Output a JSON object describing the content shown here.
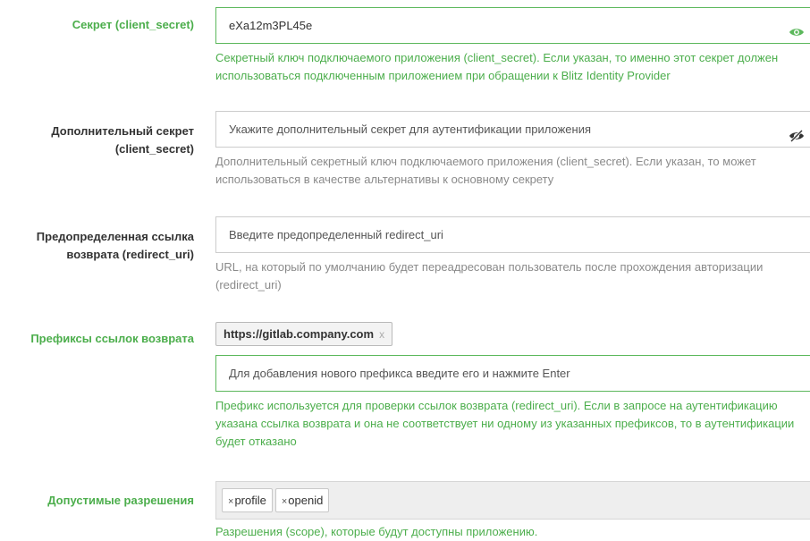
{
  "secret": {
    "label": "Секрет (client_secret)",
    "value": "eXa12m3PL45e",
    "icon": "eye-icon",
    "help": "Секретный ключ подключаемого приложения (client_secret). Если указан, то именно этот секрет должен использоваться подключенным приложением при обращении к Blitz Identity Provider"
  },
  "additional_secret": {
    "label_line1": "Дополнительный секрет",
    "label_line2": "(client_secret)",
    "placeholder": "Укажите дополнительный секрет для аутентификации приложения",
    "icon": "eye-slash-icon",
    "help": "Дополнительный секретный ключ подключаемого приложения (client_secret). Если указан, то может использоваться в качестве альтернативы к основному секрету"
  },
  "redirect_uri": {
    "label_line1": "Предопределенная ссылка",
    "label_line2": "возврата (redirect_uri)",
    "placeholder": "Введите предопределенный redirect_uri",
    "help": "URL, на который по умолчанию будет переадресован пользователь после прохождения авторизации (redirect_uri)"
  },
  "prefixes": {
    "label": "Префиксы ссылок возврата",
    "tags": [
      {
        "text": "https://gitlab.company.com",
        "remove": "x"
      }
    ],
    "placeholder": "Для добавления нового префикса введите его и нажмите Enter",
    "help": "Префикс используется для проверки ссылок возврата (redirect_uri). Если в запросе на аутентификацию указана ссылка возврата и она не соответствует ни одному из указанных префиксов, то в аутентификации будет отказано"
  },
  "scopes": {
    "label": "Допустимые разрешения",
    "items": [
      {
        "remove": "×",
        "text": "profile"
      },
      {
        "remove": "×",
        "text": "openid"
      }
    ],
    "help": "Разрешения (scope), которые будут доступны приложению."
  },
  "colors": {
    "green": "#4cae4c",
    "gray": "#8a8a8a",
    "border_green": "#5cb85c"
  }
}
